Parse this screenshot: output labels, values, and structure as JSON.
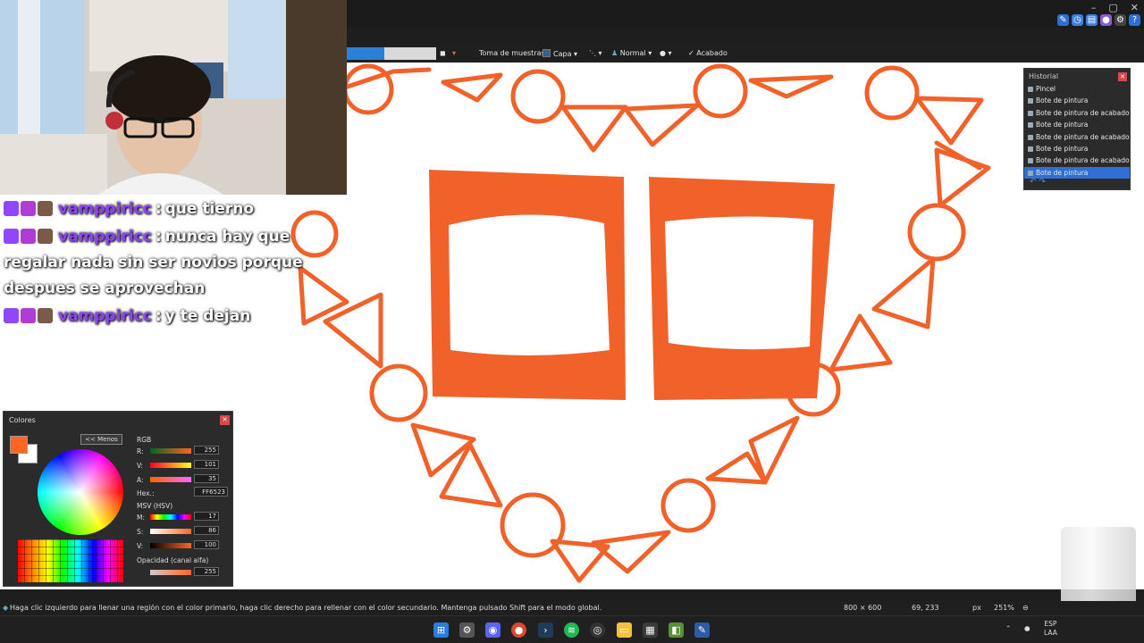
{
  "toolbar": {
    "sampling_label": "Toma de muestras:",
    "sampling_value": "Capa",
    "blend_mode": "Normal",
    "finish_label": "Acabado"
  },
  "chat": {
    "messages": [
      {
        "user": "vamppiricc",
        "text": "que tierno"
      },
      {
        "user": "vamppiricc",
        "text": "nunca hay que regalar nada sin ser novios porque despues se aprovechan"
      },
      {
        "user": "vamppiricc",
        "text": "y te dejan"
      }
    ]
  },
  "history": {
    "title": "Historial",
    "items": [
      "Pincel",
      "Bote de pintura",
      "Bote de pintura de acabado",
      "Bote de pintura",
      "Bote de pintura de acabado",
      "Bote de pintura",
      "Bote de pintura de acabado",
      "Bote de pintura"
    ],
    "selected_index": 7
  },
  "colors_panel": {
    "title": "Colores",
    "less_button": "<< Menos",
    "rgb_label": "RGB",
    "r_label": "R:",
    "r_value": "255",
    "g_label": "V:",
    "g_value": "101",
    "b_label": "A:",
    "b_value": "35",
    "hex_label": "Hex.:",
    "hex_value": "FF6523",
    "hsv_label": "MSV (HSV)",
    "h_label": "M:",
    "h_value": "17",
    "s_label": "S:",
    "s_value": "86",
    "v_label": "V:",
    "v_value": "100",
    "opacity_label": "Opacidad (canal alfa)",
    "opacity_value": "255",
    "primary_color": "#FF6523",
    "secondary_color": "#FFFFFF"
  },
  "status_bar": {
    "hint": "Haga clic izquierdo para llenar una región con el color primario, haga clic derecho para rellenar con el color secundario. Mantenga pulsado Shift para el modo global.",
    "image_size": "800 × 600",
    "cursor_pos": "69, 233",
    "unit": "px",
    "zoom": "251%"
  },
  "taskbar": {
    "lang": "ESP",
    "region": "LAA",
    "apps": [
      "start-icon",
      "settings-icon",
      "discord-icon",
      "chrome-icon",
      "terminal-icon",
      "spotify-icon",
      "obs-icon",
      "file-explorer-icon",
      "store-icon",
      "minecraft-icon",
      "paintdotnet-icon"
    ]
  },
  "accent_color": "#FF6523"
}
